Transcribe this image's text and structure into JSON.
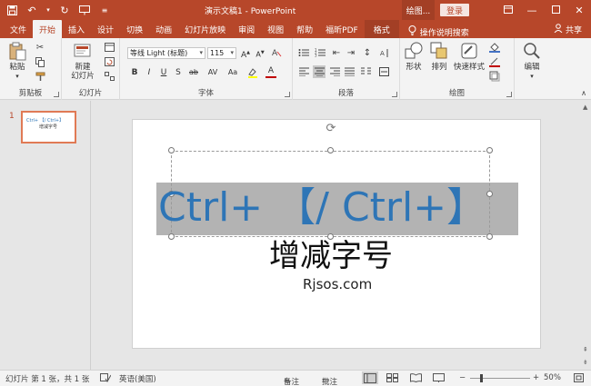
{
  "app": {
    "title": "演示文稿1  -  PowerPoint",
    "context_title": "绘图...",
    "login_label": "登录",
    "accent": "#b7472a"
  },
  "window_controls": [
    "restore-icon",
    "minimize-icon",
    "maximize-icon",
    "close-icon"
  ],
  "tabs": [
    {
      "label": "文件"
    },
    {
      "label": "开始"
    },
    {
      "label": "插入"
    },
    {
      "label": "设计"
    },
    {
      "label": "切换"
    },
    {
      "label": "动画"
    },
    {
      "label": "幻灯片放映"
    },
    {
      "label": "审阅"
    },
    {
      "label": "视图"
    },
    {
      "label": "帮助"
    },
    {
      "label": "福昕PDF"
    },
    {
      "label": "格式"
    }
  ],
  "tell_me": "操作说明搜索",
  "share": "共享",
  "ribbon": {
    "clipboard": {
      "paste_label": "粘贴",
      "group_label": "剪贴板"
    },
    "slides": {
      "new_slide_label": "新建\n幻灯片",
      "group_label": "幻灯片"
    },
    "font": {
      "font_name": "等线 Light (标题)",
      "font_size": "115",
      "group_label": "字体",
      "buttons": [
        "B",
        "I",
        "U",
        "S",
        "ab",
        "AV",
        "Aa",
        "A"
      ]
    },
    "paragraph": {
      "group_label": "段落"
    },
    "drawing": {
      "shape_label": "形状",
      "arrange_label": "排列",
      "quick_styles_label": "快速样式",
      "group_label": "绘图"
    },
    "editing": {
      "edit_label": "编辑"
    }
  },
  "thumbnail": {
    "number": "1",
    "line1": "Ctrl+ 【/ Ctrl+】",
    "line2": "增减字号"
  },
  "slide": {
    "main_line": "Ctrl+ 【/ Ctrl+】",
    "subtitle": "增减字号",
    "site": "Rjsos.com",
    "main_color": "#2e75b6"
  },
  "status": {
    "slide_info": "幻灯片 第 1 张，共 1 张",
    "language": "英语(美国)",
    "notes": "备注",
    "comments": "批注",
    "zoom": "50%"
  }
}
